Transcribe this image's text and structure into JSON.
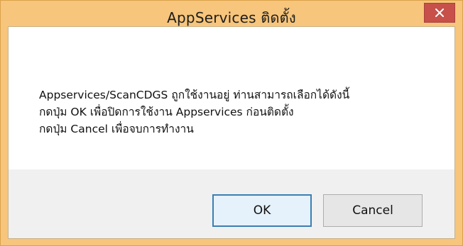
{
  "window": {
    "title": "AppServices ติดตั้ง",
    "close_icon": "close-icon"
  },
  "message": {
    "lines": [
      "Appservices/ScanCDGS ถูกใช้งานอยู่ ท่านสามารถเลือกได้ดังนี้",
      "กดปุ่ม OK เพื่อปิดการใช้งาน Appservices ก่อนติดตั้ง",
      "กดปุ่ม Cancel เพื่อจบการทำงาน"
    ]
  },
  "buttons": {
    "ok_label": "OK",
    "cancel_label": "Cancel"
  },
  "colors": {
    "titlebar": "#f7c57b",
    "close_button": "#c7504a",
    "default_button_border": "#3c7fb1"
  }
}
